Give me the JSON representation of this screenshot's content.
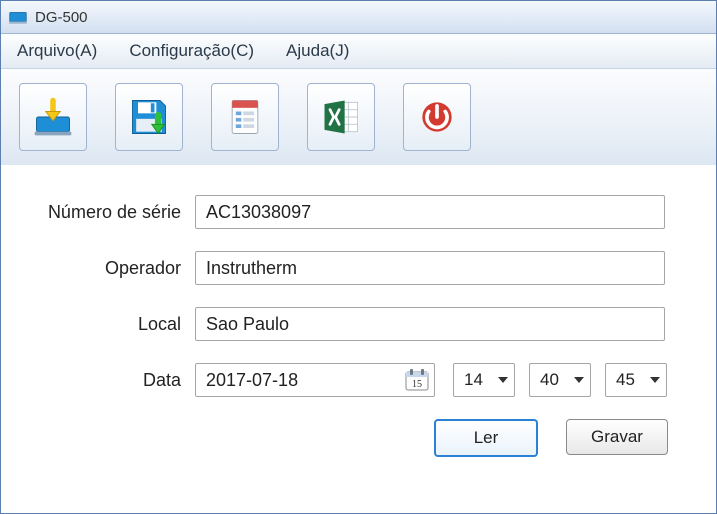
{
  "window": {
    "title": "DG-500"
  },
  "menubar": {
    "arquivo": "Arquivo(A)",
    "configuracao": "Configuração(C)",
    "ajuda": "Ajuda(J)"
  },
  "toolbar": {
    "download": "download-icon",
    "save": "save-icon",
    "report": "report-icon",
    "excel": "excel-icon",
    "power": "power-icon"
  },
  "form": {
    "serial_label": "Número de série",
    "serial_value": "AC13038097",
    "operator_label": "Operador",
    "operator_value": "Instrutherm",
    "local_label": "Local",
    "local_value": "Sao Paulo",
    "date_label": "Data",
    "date_value": "2017-07-18",
    "hour": "14",
    "minute": "40",
    "second": "45"
  },
  "buttons": {
    "read": "Ler",
    "write": "Gravar"
  },
  "colors": {
    "accent_blue": "#1e8fd6",
    "excel_green": "#217346",
    "power_red": "#d43a2f",
    "save_green": "#2fbf3a"
  }
}
